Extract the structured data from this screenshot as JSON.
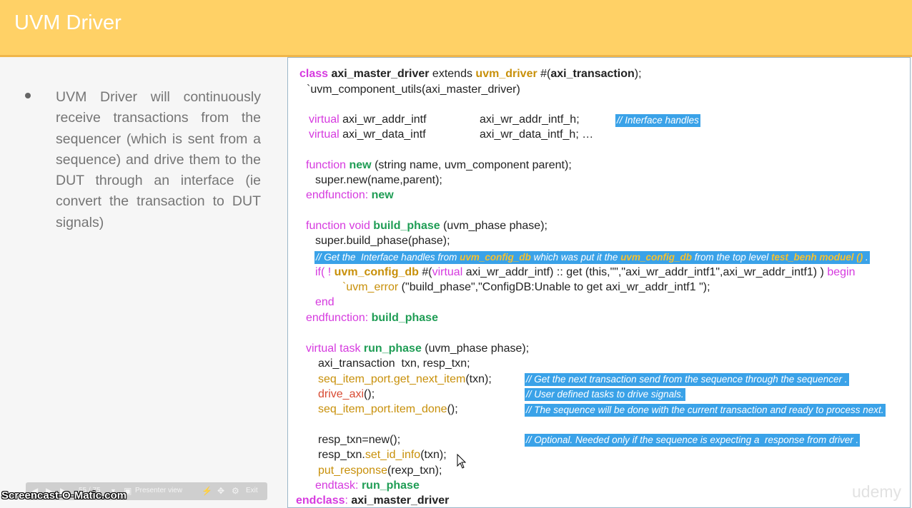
{
  "slide": {
    "title": "UVM Driver",
    "bullet": "UVM Driver will continuously receive transactions from the sequencer (which is sent from a sequence) and drive them to the DUT through an interface (ie convert the transaction to DUT signals)"
  },
  "code": {
    "class": "class",
    "class_name": "axi_master_driver",
    "extends": " extends ",
    "uvm_driver": "uvm_driver",
    "param": " #(",
    "param_type": "axi_transaction",
    "param_end": ");",
    "utils": "`uvm_component_utils(axi_master_driver)",
    "virtual": "virtual",
    "wr_addr_type": " axi_wr_addr_intf",
    "wr_addr_var": "axi_wr_addr_intf_h;",
    "cmt_handles": "// Interface handles",
    "wr_data_type": " axi_wr_data_intf",
    "wr_data_var": "axi_wr_data_intf_h; …",
    "function": "function",
    "new": "new",
    "new_args": " (string name, uvm_component parent);",
    "super_new": "super.new(name,parent);",
    "endfunction": "endfunction",
    "colon": ": ",
    "function_void": "function void",
    "build_phase": "build_phase",
    "phase_args": " (uvm_phase phase);",
    "super_build": "super.build_phase(phase);",
    "cmt_get_1": "// Get the  Interface handles from ",
    "cmt_get_hl1": "uvm_config_db",
    "cmt_get_2": " which was put it the ",
    "cmt_get_hl2": "uvm_config_db",
    "cmt_get_3": " from the top level ",
    "cmt_get_hl3": "test_benh moduel ()",
    "cmt_get_4": " .",
    "if_open": "if( ! ",
    "config_db": "uvm_config_db",
    "hash_paren": " #(",
    "virtual_kw": "virtual",
    "if_args": " axi_wr_addr_intf) :: get (this,\"\",\"axi_wr_addr_intf1\",axi_wr_addr_intf1) ) ",
    "begin": "begin",
    "uvm_error": "`uvm_error",
    "error_args": " (\"build_phase\",\"ConfigDB:Unable to get axi_wr_addr_intf1 \");",
    "end": "end",
    "virtual_task": "virtual task",
    "run_phase": "run_phase",
    "txn_decl": "axi_transaction  txn, resp_txn;",
    "get_next": "seq_item_port.get_next_item",
    "get_next_args": "(txn);",
    "cmt_next": "// Get the next transaction send from the sequence through the sequencer .",
    "drive_axi": "drive_axi",
    "drive_args": "();",
    "cmt_drive": "// User defined tasks to drive signals.",
    "item_done": "seq_item_port.item_done",
    "item_done_args": "();",
    "cmt_done": "// The sequence will be done with the current transaction and ready to process next.",
    "resp_new": "resp_txn=new();",
    "cmt_optional": "// Optional. Needed only if the sequence is expecting a  response from driver .",
    "resp_txn": "resp_txn.",
    "set_id": "set_id_info",
    "set_id_args": "(txn);",
    "put_resp": "put_response",
    "put_args": "(rexp_txn);",
    "endtask": "endtask",
    "endclass": "endclass",
    "endclass_name": "axi_master_driver"
  },
  "toolbar": {
    "slide_num": "55 / 75",
    "presenter": "Presenter view",
    "exit": "Exit"
  },
  "watermark": "Screencast-O-Matic.com",
  "brand": "udemy"
}
